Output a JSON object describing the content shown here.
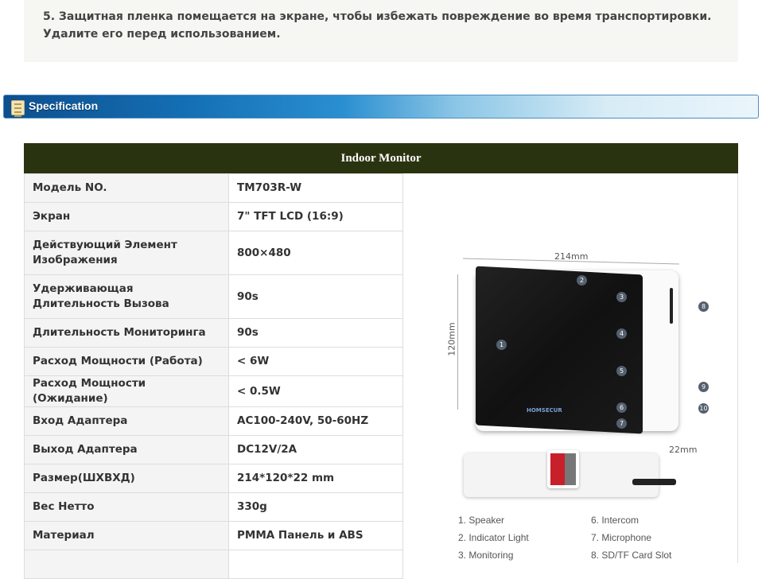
{
  "note": "5. Защитная пленка помещается на экране, чтобы избежать повреждение во время транспортировки. Удалите его перед использованием.",
  "banner": "Specification",
  "table_title": "Indoor Monitor",
  "rows": [
    {
      "label": "Модель NO.",
      "value": "TM703R-W"
    },
    {
      "label": "Экран",
      "value": "7\" TFT LCD (16:9)"
    },
    {
      "label": "Действующий Элемент Изображения",
      "value": "800×480"
    },
    {
      "label": "Удерживающая Длительность Вызова",
      "value": "90s"
    },
    {
      "label": "Длительность Мониторинга",
      "value": "90s"
    },
    {
      "label": "Расход Мощности (Работа)",
      "value": "< 6W"
    },
    {
      "label": "Расход Мощности (Ожидание)",
      "value": "< 0.5W"
    },
    {
      "label": "Вход Адаптера",
      "value": "AC100-240V, 50-60HZ"
    },
    {
      "label": "Выход Адаптера",
      "value": "DC12V/2A"
    },
    {
      "label": "Размер(ШХВХД)",
      "value": "214*120*22 mm"
    },
    {
      "label": "Вес Нетто",
      "value": "330g"
    },
    {
      "label": "Материал",
      "value": "PMMA Панель и ABS"
    },
    {
      "label": "",
      "value": ""
    }
  ],
  "figure": {
    "width": "214mm",
    "height": "120mm",
    "depth": "22mm",
    "brand": "HOMSECUR",
    "legend": [
      "1. Speaker",
      "2. Indicator Light",
      "3. Monitoring",
      "6. Intercom",
      "7. Microphone",
      "8. SD/TF Card Slot"
    ],
    "markers": [
      "1",
      "2",
      "3",
      "4",
      "5",
      "6",
      "7",
      "8",
      "9",
      "10"
    ]
  }
}
